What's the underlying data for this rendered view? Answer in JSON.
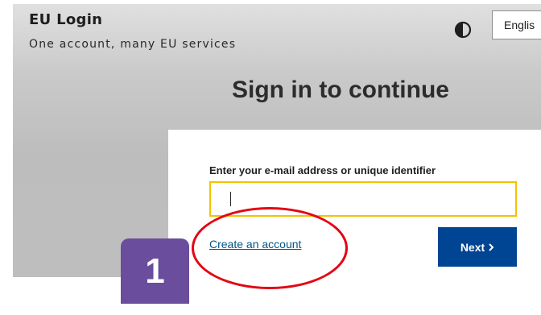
{
  "header": {
    "brand_title": "EU Login",
    "brand_subtitle": "One account, many EU services",
    "contrast_icon": "contrast-toggle-icon",
    "language_label": "Englis"
  },
  "main": {
    "title": "Sign in to continue",
    "form": {
      "email_label": "Enter your e-mail address or unique identifier",
      "email_value": "",
      "create_account_label": "Create an account",
      "next_label": "Next",
      "next_icon": "chevron-right-icon"
    }
  },
  "annotation": {
    "step_number": "1",
    "highlight_color": "#e30613",
    "badge_color": "#6a4d9c"
  },
  "colors": {
    "accent_yellow": "#f3c200",
    "primary_blue": "#004494",
    "link_blue": "#00558a"
  }
}
